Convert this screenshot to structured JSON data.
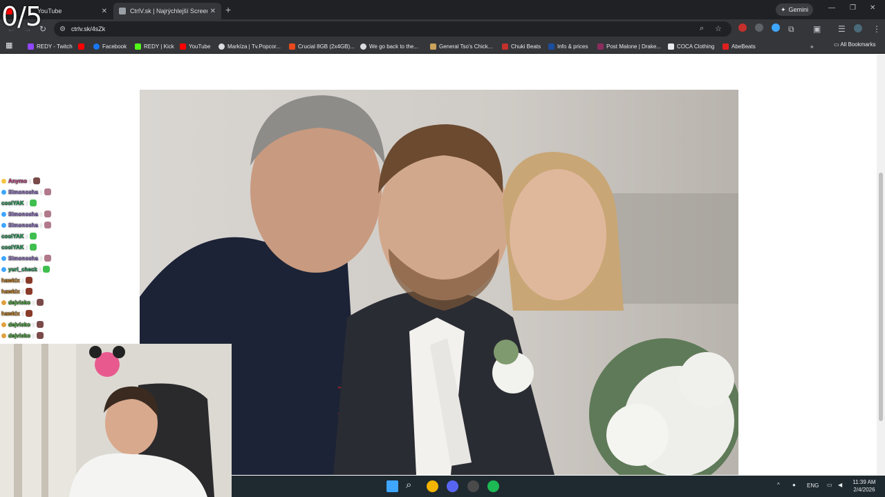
{
  "overlay": {
    "counter": "0/5"
  },
  "tabs": [
    {
      "title": "YouTube",
      "color": "#ff0000"
    },
    {
      "title": "CtrlV.sk | Najrýchlejší ScreenSh",
      "color": "#9aa0a6"
    }
  ],
  "gemini": {
    "label": "Gemini"
  },
  "omnibox": {
    "url": "ctrlv.sk/4sZk"
  },
  "bookmarks": [
    {
      "label": "REDY - Twitch",
      "color": "#9146ff"
    },
    {
      "label": "",
      "color": "#ff0000"
    },
    {
      "label": "Facebook",
      "color": "#1877f2"
    },
    {
      "label": "REDY | Kick",
      "color": "#53fc18"
    },
    {
      "label": "YouTube",
      "color": "#ff0000"
    },
    {
      "label": "Markíza | Tv.Popcor...",
      "color": "#dadce0"
    },
    {
      "label": "Crucial 8GB (2x4GB)...",
      "color": "#e8491d"
    },
    {
      "label": "We go back to the...",
      "color": "#dadce0"
    },
    {
      "label": "General Tso's Chick...",
      "color": "#c9a25b"
    },
    {
      "label": "Chuki Beats",
      "color": "#c4302b"
    },
    {
      "label": "Info & prices",
      "color": "#1a4d9c"
    },
    {
      "label": "Post Malone | Drake...",
      "color": "#8a2d5c"
    },
    {
      "label": "COCA Clothing",
      "color": "#e8eaed"
    },
    {
      "label": "AbeBeats",
      "color": "#e02020"
    }
  ],
  "all_bookmarks": "All Bookmarks",
  "chat": [
    {
      "user": "Anymo",
      "color": "#ff4fa3"
    },
    {
      "user": "Simonosha",
      "color": "#b58cff"
    },
    {
      "user": "coolYAK",
      "color": "#2ecc71"
    },
    {
      "user": "Simonosha",
      "color": "#b58cff"
    },
    {
      "user": "Simonosha",
      "color": "#b58cff"
    },
    {
      "user": "coolYAK",
      "color": "#2ecc71"
    },
    {
      "user": "coolYAK",
      "color": "#2ecc71"
    },
    {
      "user": "Simonosha",
      "color": "#b58cff"
    },
    {
      "user": "yuri_check",
      "color": "#2ecc71"
    },
    {
      "user": "hawkix",
      "color": "#ff9f1a"
    },
    {
      "user": "hawkix",
      "color": "#ff9f1a"
    },
    {
      "user": "dejvisko",
      "color": "#4cd137"
    },
    {
      "user": "hawkix",
      "color": "#ff9f1a"
    },
    {
      "user": "dejvisko",
      "color": "#4cd137"
    },
    {
      "user": "dejvisko",
      "color": "#4cd137"
    }
  ],
  "tray": {
    "language": "ENG",
    "time": "11:39 AM",
    "date": "2/4/2026"
  }
}
